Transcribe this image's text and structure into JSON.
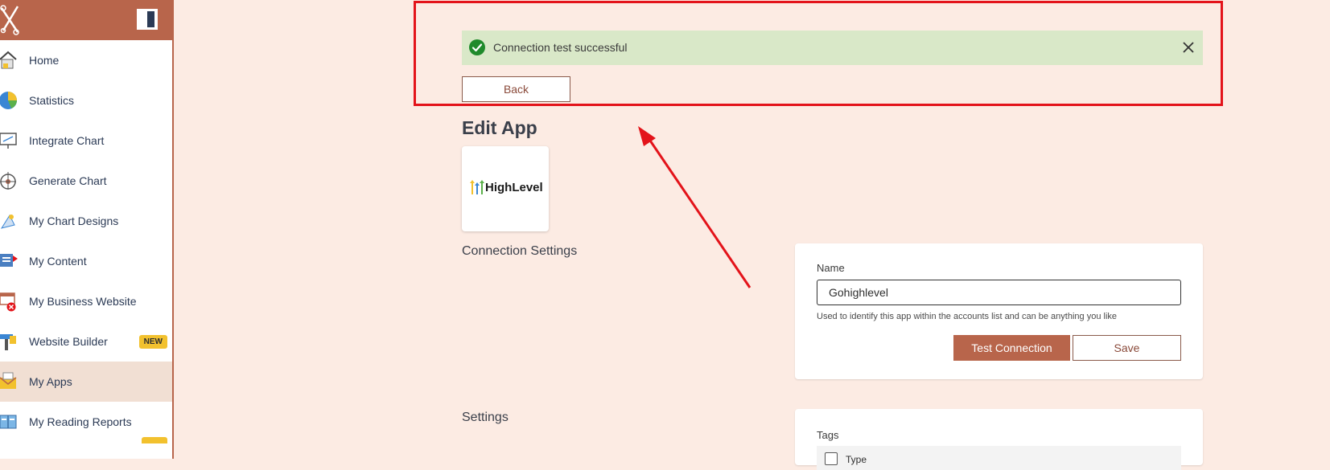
{
  "colors": {
    "brand": "#b8654b",
    "background": "#fcebe3",
    "alert_bg": "#d9e8c8",
    "success": "#1f8a2b",
    "highlight": "#e3131a",
    "badge": "#f2c12e"
  },
  "sidebar": {
    "items": [
      {
        "label": "Home",
        "icon": "house-icon"
      },
      {
        "label": "Statistics",
        "icon": "pie-chart-icon"
      },
      {
        "label": "Integrate Chart",
        "icon": "monitor-chart-icon"
      },
      {
        "label": "Generate Chart",
        "icon": "chart-wheel-icon"
      },
      {
        "label": "My Chart Designs",
        "icon": "design-icon"
      },
      {
        "label": "My Content",
        "icon": "content-icon"
      },
      {
        "label": "My Business Website",
        "icon": "website-icon"
      },
      {
        "label": "Website Builder",
        "icon": "hammer-icon",
        "badge": "NEW"
      },
      {
        "label": "My Apps",
        "icon": "envelope-icon",
        "active": true
      },
      {
        "label": "My Reading Reports",
        "icon": "book-icon"
      }
    ]
  },
  "alert": {
    "message": "Connection test successful",
    "icon": "check-circle-icon"
  },
  "actions": {
    "back_label": "Back"
  },
  "page": {
    "title": "Edit App",
    "app_brand": "HighLevel"
  },
  "connection": {
    "section_title": "Connection Settings",
    "name_label": "Name",
    "name_value": "Gohighlevel",
    "helper": "Used to identify this app within the accounts list and can be anything you like",
    "test_label": "Test Connection",
    "save_label": "Save"
  },
  "settings": {
    "section_title": "Settings",
    "tags_label": "Tags",
    "type_label": "Type"
  }
}
